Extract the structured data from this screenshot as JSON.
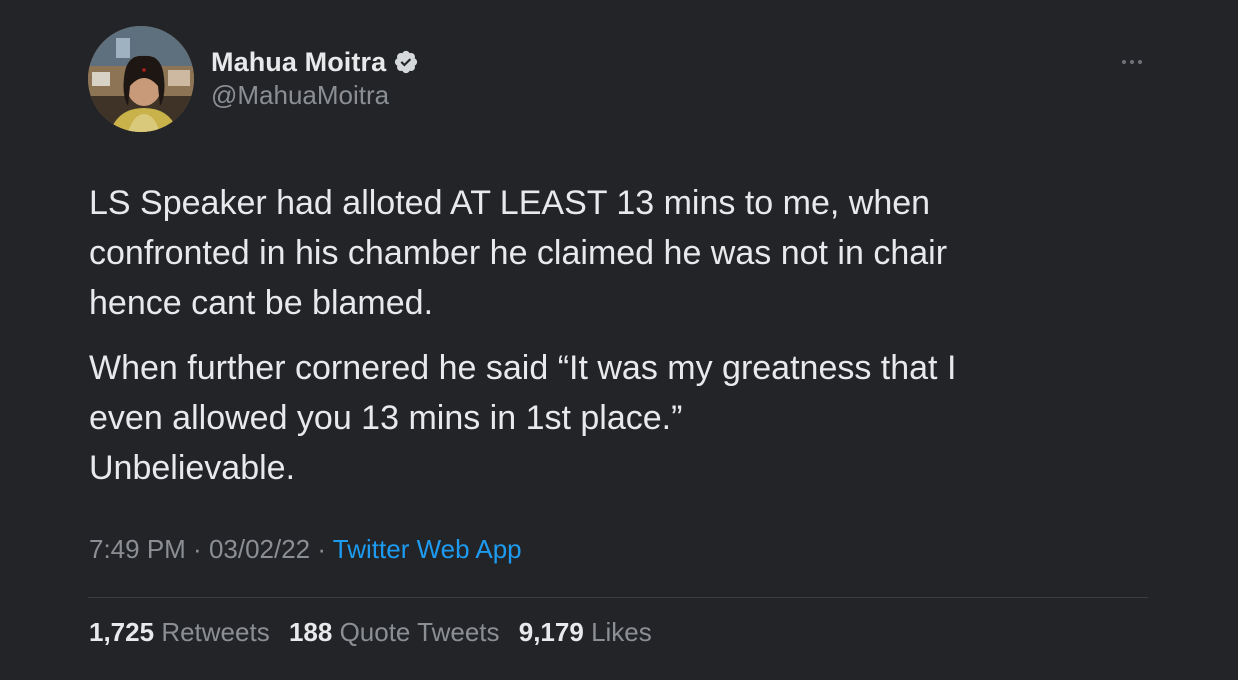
{
  "author": {
    "display_name": "Mahua Moitra",
    "handle": "@MahuaMoitra",
    "verified_icon": "verified-badge-icon",
    "avatar": "profile-photo"
  },
  "more_icon": "more-options-icon",
  "tweet": {
    "paragraph_1": "LS Speaker had alloted AT LEAST 13 mins to me, when\nconfronted in his chamber he claimed he was not in chair\nhence cant be blamed.",
    "paragraph_2": "When further cornered he said “It was my greatness that I\neven allowed you 13 mins in 1st place.”\nUnbelievable."
  },
  "meta": {
    "time": "7:49 PM",
    "separator_1": " · ",
    "date": "03/02/22",
    "separator_2": " · ",
    "source": "Twitter Web App"
  },
  "stats": {
    "retweets_count": "1,725",
    "retweets_label": "Retweets",
    "quotes_count": "188",
    "quotes_label": "Quote Tweets",
    "likes_count": "9,179",
    "likes_label": "Likes"
  },
  "colors": {
    "background": "#232427",
    "text_primary": "#e7e9ea",
    "text_secondary": "#8b8f94",
    "link": "#1d9bf0"
  }
}
